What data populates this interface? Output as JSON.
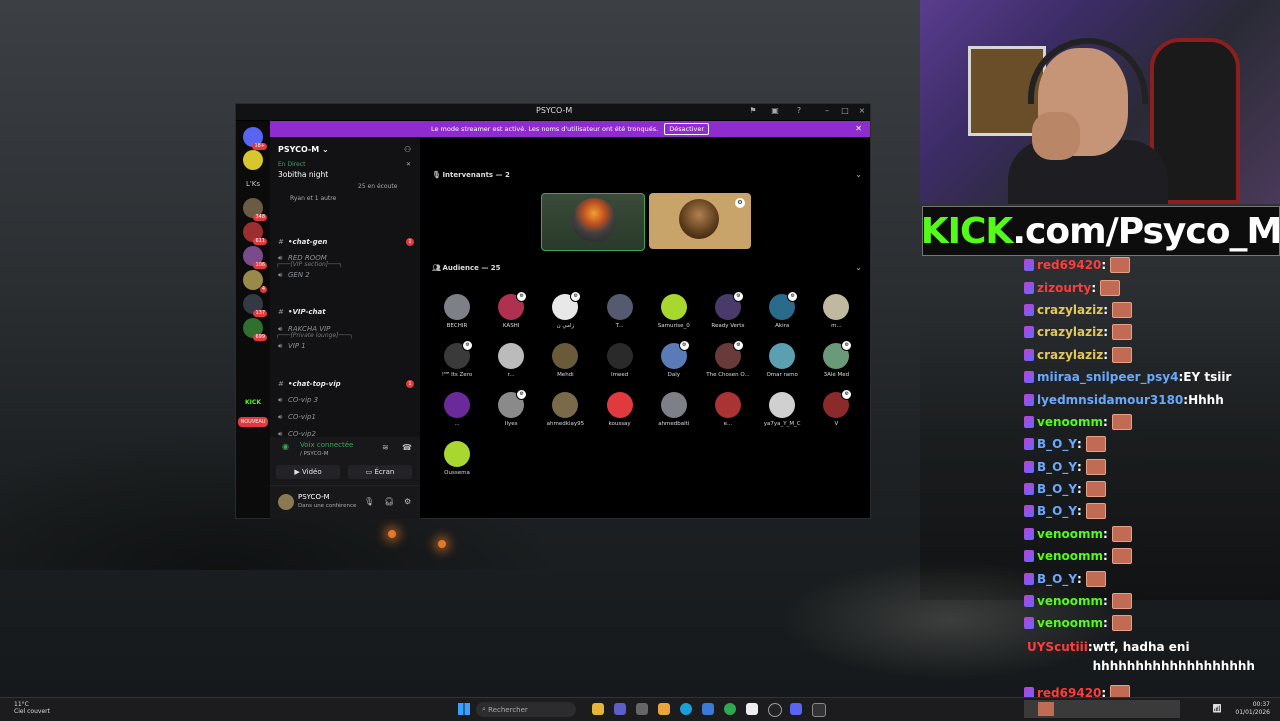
{
  "colors": {
    "discord_purple": "#8f2ccf",
    "kick_green": "#53fc18",
    "unread_red": "#e03a3e",
    "connected_green": "#3ba55c"
  },
  "desktop": {
    "wallpaper": "moonlit river landscape painting"
  },
  "webcam": {
    "banner_prefix": "KICK",
    "banner_suffix": ".com/Psyco_M"
  },
  "chat": {
    "messages": [
      {
        "user": "red69420",
        "color": "#ff3b3b",
        "text": ""
      },
      {
        "user": "zizourty",
        "color": "#ff3b3b",
        "text": ""
      },
      {
        "user": "crazylaziz",
        "color": "#e2c75a",
        "text": ""
      },
      {
        "user": "crazylaziz",
        "color": "#e2c75a",
        "text": ""
      },
      {
        "user": "crazylaziz",
        "color": "#e2c75a",
        "text": ""
      },
      {
        "user": "miiraa_snilpeer_psy4",
        "color": "#6aa8ff",
        "text": "EY tsiir"
      },
      {
        "user": "lyedmnsidamour3180",
        "color": "#6aa8ff",
        "text": "Hhhh"
      },
      {
        "user": "venoomm",
        "color": "#53fc18",
        "text": ""
      },
      {
        "user": "B_O_Y",
        "color": "#6aa8ff",
        "text": ""
      },
      {
        "user": "B_O_Y",
        "color": "#6aa8ff",
        "text": ""
      },
      {
        "user": "B_O_Y",
        "color": "#6aa8ff",
        "text": ""
      },
      {
        "user": "B_O_Y",
        "color": "#6aa8ff",
        "text": ""
      },
      {
        "user": "venoomm",
        "color": "#53fc18",
        "text": ""
      },
      {
        "user": "venoomm",
        "color": "#53fc18",
        "text": ""
      },
      {
        "user": "B_O_Y",
        "color": "#6aa8ff",
        "text": ""
      },
      {
        "user": "venoomm",
        "color": "#53fc18",
        "text": ""
      },
      {
        "user": "venoomm",
        "color": "#53fc18",
        "text": ""
      },
      {
        "user": "UYScutiii",
        "color": "#ff3b3b",
        "text": "wtf, hadha eni hhhhhhhhhhhhhhhhhhh"
      },
      {
        "user": "red69420",
        "color": "#ff3b3b",
        "text": ""
      }
    ]
  },
  "discord": {
    "title": "PSYCO-M",
    "notice": "Le mode streamer est activé. Les noms d'utilisateur ont été tronqués.",
    "notice_button": "Désactiver",
    "guild_label_lks": "L'Ks",
    "guild_label_kick": "KICK",
    "guild_label_new": "NOUVEAU",
    "guild_badges": [
      "18+",
      "348",
      "611",
      "106",
      "4",
      "137",
      "699"
    ],
    "server_name": "PSYCO-M",
    "event": {
      "live": "En Direct",
      "title": "3obitha night",
      "listeners": "25 en écoute",
      "speakers": "Ryan et 1 autre"
    },
    "categories": [
      "┌───[VIP section]───┐",
      "┌───[Private lounge]───┐"
    ],
    "channels": [
      {
        "name": "•chat-gen",
        "type": "text",
        "unread": true,
        "count": "1"
      },
      {
        "name": "RED ROOM",
        "type": "voice",
        "unread": false
      },
      {
        "name": "GEN 2",
        "type": "voice",
        "unread": false
      },
      {
        "name": "•VIP-chat",
        "type": "text",
        "unread": true
      },
      {
        "name": "RAKCHA VIP",
        "type": "voice",
        "unread": false
      },
      {
        "name": "VIP 1",
        "type": "voice",
        "unread": false
      },
      {
        "name": "•chat-top-vip",
        "type": "text",
        "unread": true,
        "count": "1"
      },
      {
        "name": "CO-vip 3",
        "type": "voice",
        "unread": false
      },
      {
        "name": "CO-vip1",
        "type": "voice",
        "unread": false
      },
      {
        "name": "CO-vip2",
        "type": "voice",
        "unread": false
      }
    ],
    "voice": {
      "status": "Voix connectée",
      "channel": "/ PSYCO-M",
      "video": "Vidéo",
      "screen": "Écran"
    },
    "user": {
      "name": "PSYCO-M",
      "status": "Dans une conférence"
    },
    "speakers_header": "Intervenants — 2",
    "audience_header": "Audience — 25",
    "audience": [
      "BECHIR",
      "KASHI",
      "زامي ن",
      "T...",
      "Samurise_0",
      "Ready Vertx",
      "Akira",
      "m...",
      "!ᴹᴿ Its Zero",
      "r...",
      "Mehdi",
      "Imeed",
      "Daly",
      "The Chosen O...",
      "Omar ramo",
      "3Alé Med",
      "...",
      "Ilyes",
      "ahmedklay95",
      "koussay",
      "ahmedbalti",
      "e...",
      "ya7ya_Y_M_C",
      "V",
      "Oussema"
    ]
  },
  "taskbar": {
    "weather_temp": "11°C",
    "weather_desc": "Ciel couvert",
    "search": "Rechercher",
    "time": "00:37",
    "date": "01/01/2026"
  }
}
